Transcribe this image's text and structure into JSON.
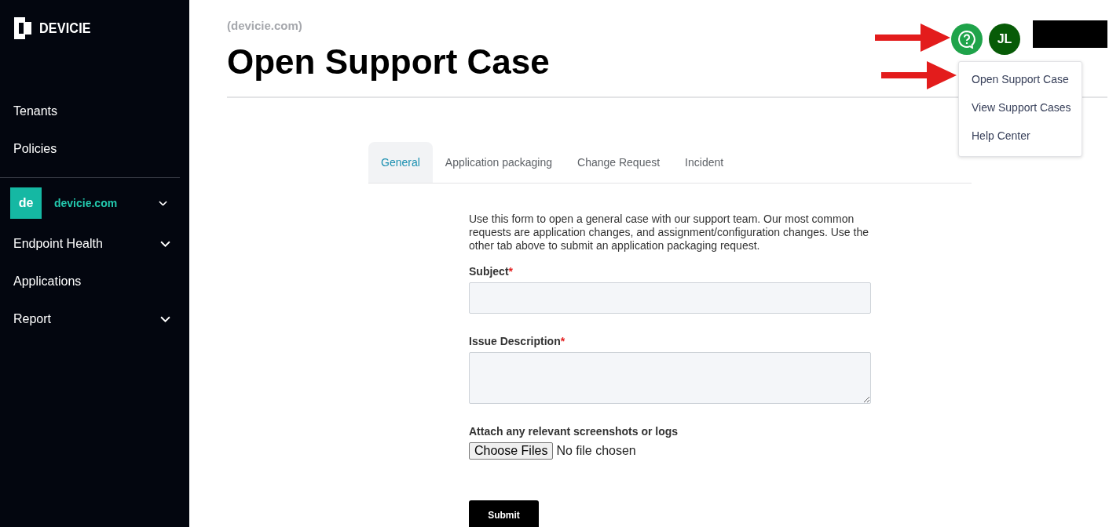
{
  "sidebar": {
    "brand": "DEVICIE",
    "nav": [
      {
        "label": "Tenants"
      },
      {
        "label": "Policies"
      }
    ],
    "tenant": {
      "badge": "de",
      "name": "devicie.com",
      "expanded": false
    },
    "menu": [
      {
        "label": "Endpoint Health",
        "has_submenu": true
      },
      {
        "label": "Applications",
        "has_submenu": false
      },
      {
        "label": "Report",
        "has_submenu": true
      }
    ]
  },
  "header": {
    "subtitle": "(devicie.com)",
    "title": "Open Support Case",
    "avatar": "JL",
    "help_menu": {
      "open": true,
      "items": [
        {
          "label": "Open Support Case"
        },
        {
          "label": "View Support Cases"
        },
        {
          "label": "Help Center"
        }
      ]
    }
  },
  "tabs": [
    {
      "label": "General",
      "selected": true
    },
    {
      "label": "Application packaging",
      "selected": false
    },
    {
      "label": "Change Request",
      "selected": false
    },
    {
      "label": "Incident",
      "selected": false
    }
  ],
  "form": {
    "intro": "Use this form to open a general case with our support team. Our most common requests are application changes, and assignment/configuration changes. Use the other tab above to submit an application packaging request.",
    "fields": [
      {
        "label": "Subject",
        "required_mark": "*",
        "kind": "input"
      },
      {
        "label": "Issue Description",
        "required_mark": "*",
        "kind": "textarea"
      }
    ],
    "attach": {
      "label": "Attach any relevant screenshots or logs",
      "button": "Choose Files",
      "status": "No file chosen"
    },
    "submit": "Submit"
  }
}
